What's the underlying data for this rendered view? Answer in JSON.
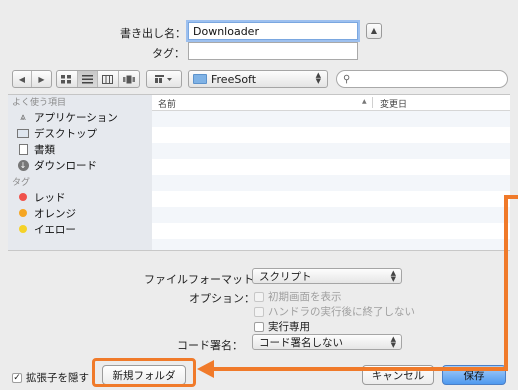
{
  "header": {
    "save_as_label": "書き出し名：",
    "save_as_value": "Downloader",
    "tags_label": "タグ：",
    "tags_value": "",
    "disclose_icon": "chevron-up"
  },
  "toolbar": {
    "back_icon": "◀",
    "forward_icon": "▶",
    "arrange_icon": "grid-dropdown",
    "location": "FreeSoft",
    "search_placeholder": ""
  },
  "sidebar": {
    "favorites_header": "よく使う項目",
    "favorites": [
      {
        "label": "アプリケーション",
        "icon": "applications-icon"
      },
      {
        "label": "デスクトップ",
        "icon": "desktop-icon"
      },
      {
        "label": "書類",
        "icon": "documents-icon"
      },
      {
        "label": "ダウンロード",
        "icon": "downloads-icon"
      }
    ],
    "tags_header": "タグ",
    "tags": [
      {
        "label": "レッド",
        "color": "#f0524b"
      },
      {
        "label": "オレンジ",
        "color": "#f5a623"
      },
      {
        "label": "イエロー",
        "color": "#f5d228"
      }
    ]
  },
  "file_list": {
    "col_name": "名前",
    "sort_indicator": "▲",
    "col_modified": "変更日"
  },
  "options": {
    "file_format_label": "ファイルフォーマット：",
    "file_format_value": "スクリプト",
    "options_label": "オプション：",
    "opt_startup": "初期画面を表示",
    "opt_stay_open": "ハンドラの実行後に終了しない",
    "opt_run_only": "実行専用",
    "code_sign_label": "コード署名：",
    "code_sign_value": "コード署名しない"
  },
  "footer": {
    "hide_ext_label": "拡張子を隠す",
    "new_folder": "新規フォルダ",
    "cancel": "キャンセル",
    "save": "保存"
  },
  "colors": {
    "annotation": "#f07a2a",
    "primary_button": "#4f9af0"
  }
}
